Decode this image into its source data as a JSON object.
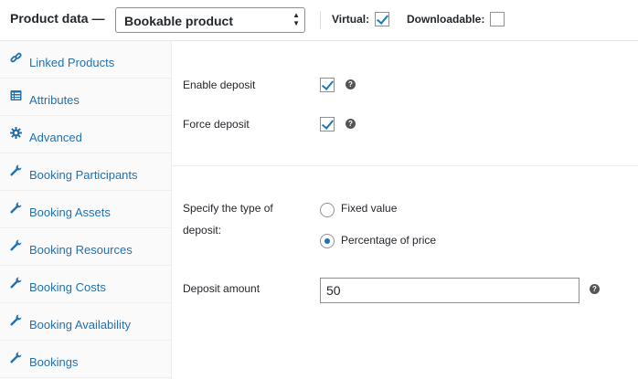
{
  "header": {
    "title": "Product data —",
    "product_type": "Bookable product",
    "virtual_label": "Virtual:",
    "virtual_checked": true,
    "downloadable_label": "Downloadable:",
    "downloadable_checked": false
  },
  "sidebar": {
    "items": [
      {
        "label": "Linked Products",
        "icon": "link-icon"
      },
      {
        "label": "Attributes",
        "icon": "list-icon"
      },
      {
        "label": "Advanced",
        "icon": "gear-icon"
      },
      {
        "label": "Booking Participants",
        "icon": "wrench-icon"
      },
      {
        "label": "Booking Assets",
        "icon": "wrench-icon"
      },
      {
        "label": "Booking Resources",
        "icon": "wrench-icon"
      },
      {
        "label": "Booking Costs",
        "icon": "wrench-icon"
      },
      {
        "label": "Booking Availability",
        "icon": "wrench-icon"
      },
      {
        "label": "Bookings",
        "icon": "wrench-icon"
      }
    ]
  },
  "main": {
    "enable_deposit_label": "Enable deposit",
    "enable_deposit_checked": true,
    "force_deposit_label": "Force deposit",
    "force_deposit_checked": true,
    "deposit_type_label_line1": "Specify the type of",
    "deposit_type_label_line2": "deposit:",
    "deposit_type_options": [
      {
        "label": "Fixed value",
        "selected": false
      },
      {
        "label": "Percentage of price",
        "selected": true
      }
    ],
    "deposit_amount_label": "Deposit amount",
    "deposit_amount_value": "50"
  },
  "colors": {
    "accent": "#2271b1",
    "checkmark": "#1e78b3",
    "help_icon": "#555555"
  }
}
